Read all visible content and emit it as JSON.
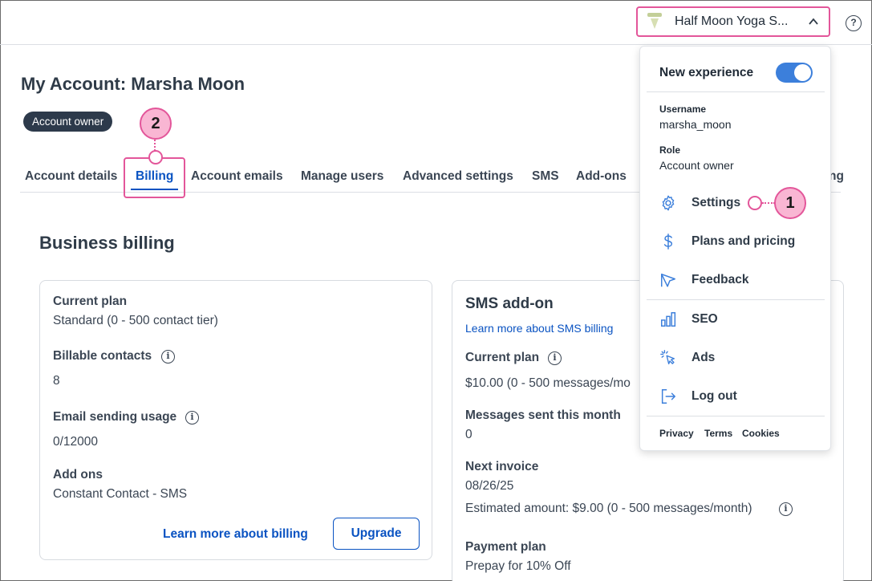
{
  "header": {
    "account_name": "Half Moon Yoga S...",
    "help_label": "?"
  },
  "page": {
    "title": "My Account: Marsha Moon",
    "role_badge": "Account owner"
  },
  "tabs": [
    {
      "label": "Account details"
    },
    {
      "label": "Billing"
    },
    {
      "label": "Account emails"
    },
    {
      "label": "Manage users"
    },
    {
      "label": "Advanced settings"
    },
    {
      "label": "SMS"
    },
    {
      "label": "Add-ons"
    },
    {
      "label": "ng"
    }
  ],
  "section_title": "Business billing",
  "plan_card": {
    "current_plan_label": "Current plan",
    "current_plan_value": "Standard (0 - 500 contact tier)",
    "billable_label": "Billable contacts",
    "billable_value": "8",
    "usage_label": "Email sending usage",
    "usage_value": "0/12000",
    "addons_label": "Add ons",
    "addons_value": "Constant Contact - SMS",
    "learn_more": "Learn more about billing",
    "upgrade": "Upgrade"
  },
  "sms_card": {
    "title": "SMS add-on",
    "learn_more": "Learn more about SMS billing",
    "current_plan_label": "Current plan",
    "current_plan_value": "$10.00 (0 - 500 messages/mo",
    "messages_label": "Messages sent this month",
    "messages_value": "0",
    "invoice_label": "Next invoice",
    "invoice_date": "08/26/25",
    "estimated": "Estimated amount: $9.00 (0 - 500 messages/month)",
    "payment_label": "Payment plan",
    "payment_value": "Prepay for 10% Off"
  },
  "dropdown": {
    "new_experience": "New experience",
    "username_label": "Username",
    "username_value": "marsha_moon",
    "role_label": "Role",
    "role_value": "Account owner",
    "items": [
      {
        "label": "Settings",
        "icon": "gear-icon"
      },
      {
        "label": "Plans and pricing",
        "icon": "dollar-icon"
      },
      {
        "label": "Feedback",
        "icon": "megaphone-icon"
      },
      {
        "label": "SEO",
        "icon": "bar-chart-icon"
      },
      {
        "label": "Ads",
        "icon": "cursor-click-icon"
      },
      {
        "label": "Log out",
        "icon": "logout-icon"
      }
    ],
    "footer": {
      "privacy": "Privacy",
      "terms": "Terms",
      "cookies": "Cookies"
    }
  },
  "callouts": {
    "one": "1",
    "two": "2"
  },
  "colors": {
    "accent": "#0a53c2",
    "highlight": "#e3569a",
    "toggle_on": "#3c7fdb"
  }
}
